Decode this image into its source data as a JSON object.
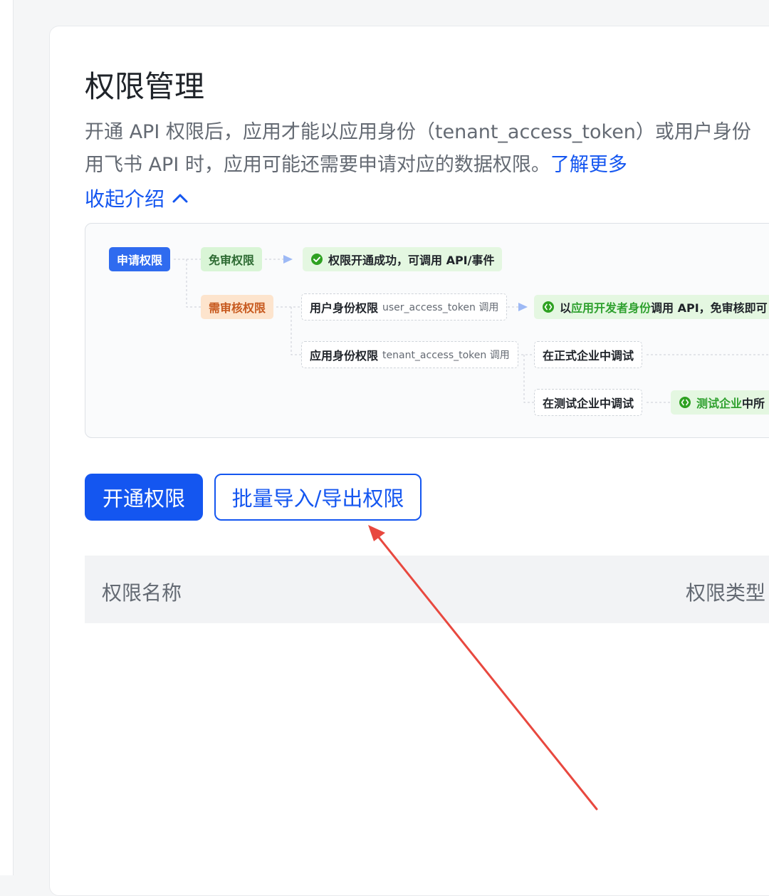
{
  "page": {
    "title": "权限管理",
    "intro_line1": "开通 API 权限后，应用才能以应用身份（tenant_access_token）或用户身份",
    "intro_line2": "用飞书 API 时，应用可能还需要申请对应的数据权限。",
    "learn_more": "了解更多",
    "collapse_label": "收起介绍",
    "collapse_icon": "chevron-up-icon",
    "accent_color": "#1456f0"
  },
  "diagram": {
    "apply": "申请权限",
    "no_review": "免审权限",
    "success": "权限开通成功，可调用 API/事件",
    "review": "需审核权限",
    "user_perm": "用户身份权限",
    "user_token": "user_access_token 调用",
    "dev_call_prefix": "以",
    "dev_call_highlight": "应用开发者身份",
    "dev_call_suffix": "调用 API，免审核即可",
    "app_perm": "应用身份权限",
    "tenant_token": "tenant_access_token 调用",
    "prod_debug": "在正式企业中调试",
    "test_debug": "在测试企业中调试",
    "test_result_highlight": "测试企业",
    "test_result_suffix": "中所"
  },
  "actions": {
    "enable": "开通权限",
    "batch": "批量导入/导出权限"
  },
  "table": {
    "columns": [
      "权限名称",
      "权限类型"
    ]
  }
}
